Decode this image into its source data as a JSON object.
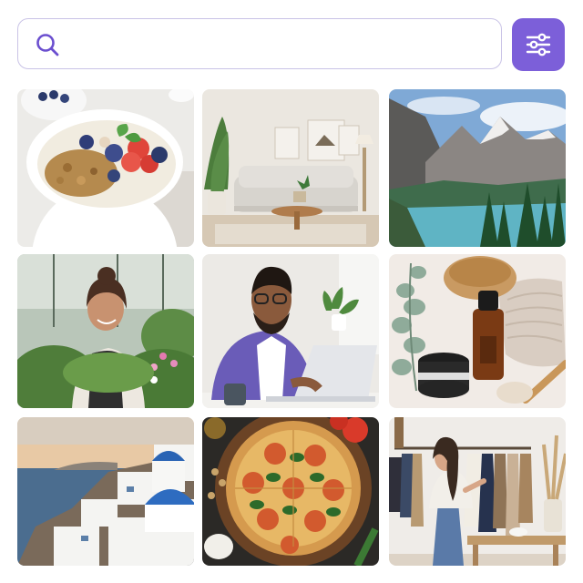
{
  "search": {
    "value": "",
    "placeholder": ""
  },
  "filter_button": {
    "icon": "sliders-icon"
  },
  "colors": {
    "accent": "#7c5fd9",
    "search_border": "#c9c3e6"
  },
  "gallery": {
    "photos": [
      {
        "subject": "yogurt-bowl-with-berries-and-granola"
      },
      {
        "subject": "living-room-interior-with-sofa"
      },
      {
        "subject": "mountain-lake-with-pine-trees"
      },
      {
        "subject": "woman-gardening-in-greenhouse"
      },
      {
        "subject": "man-working-on-laptop"
      },
      {
        "subject": "skincare-products-with-towel-and-brush"
      },
      {
        "subject": "white-houses-with-blue-domes-by-sea"
      },
      {
        "subject": "pizza-with-tomatoes-and-basil"
      },
      {
        "subject": "clothing-rack-in-boutique"
      }
    ]
  }
}
